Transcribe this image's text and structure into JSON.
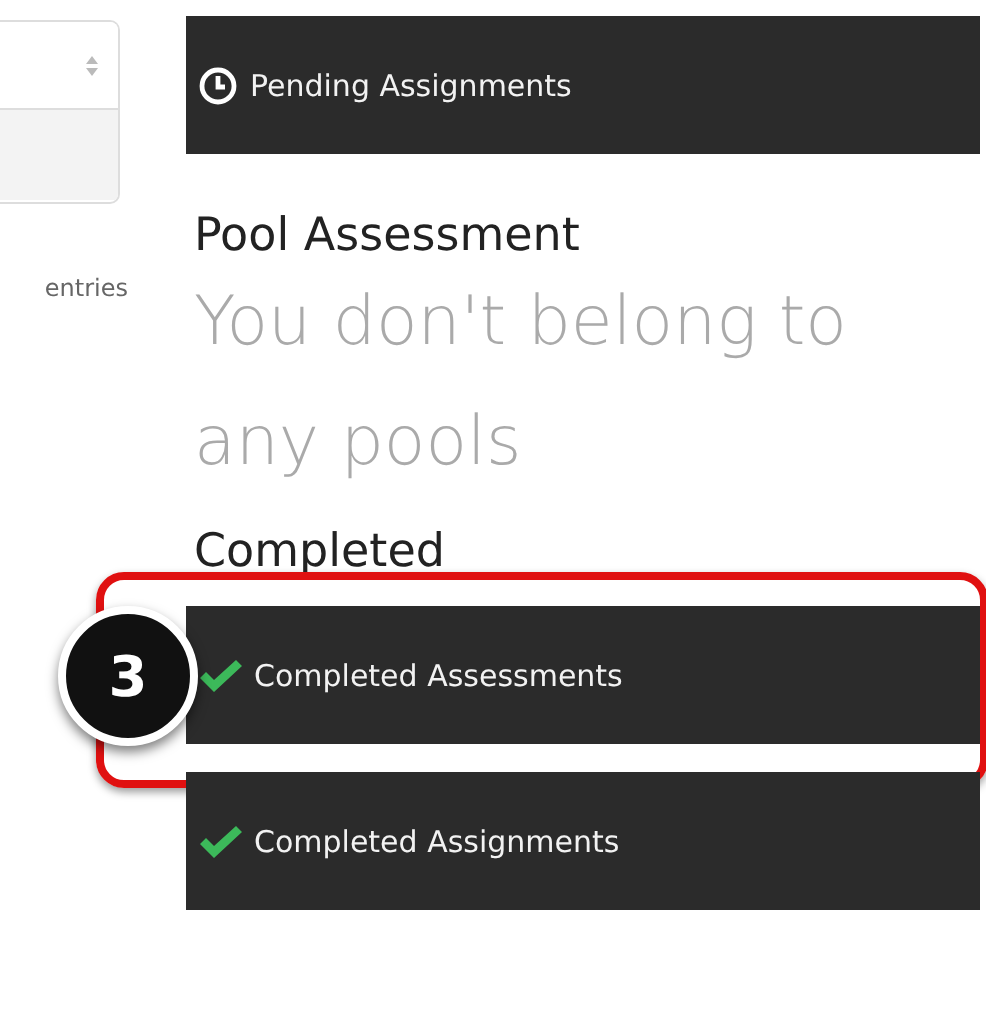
{
  "entries_control": {
    "label": "entries"
  },
  "pending_bar": {
    "kind": "pending",
    "label": "Pending Assignments"
  },
  "pool_assessment": {
    "heading": "Pool Assessment",
    "message": "You don't belong to any pools"
  },
  "completed": {
    "heading": "Completed",
    "bars": [
      {
        "kind": "completed",
        "label": "Completed Assessments",
        "highlighted": true
      },
      {
        "kind": "completed",
        "label": "Completed Assignments",
        "highlighted": false
      }
    ]
  },
  "callout": {
    "number": "3"
  }
}
